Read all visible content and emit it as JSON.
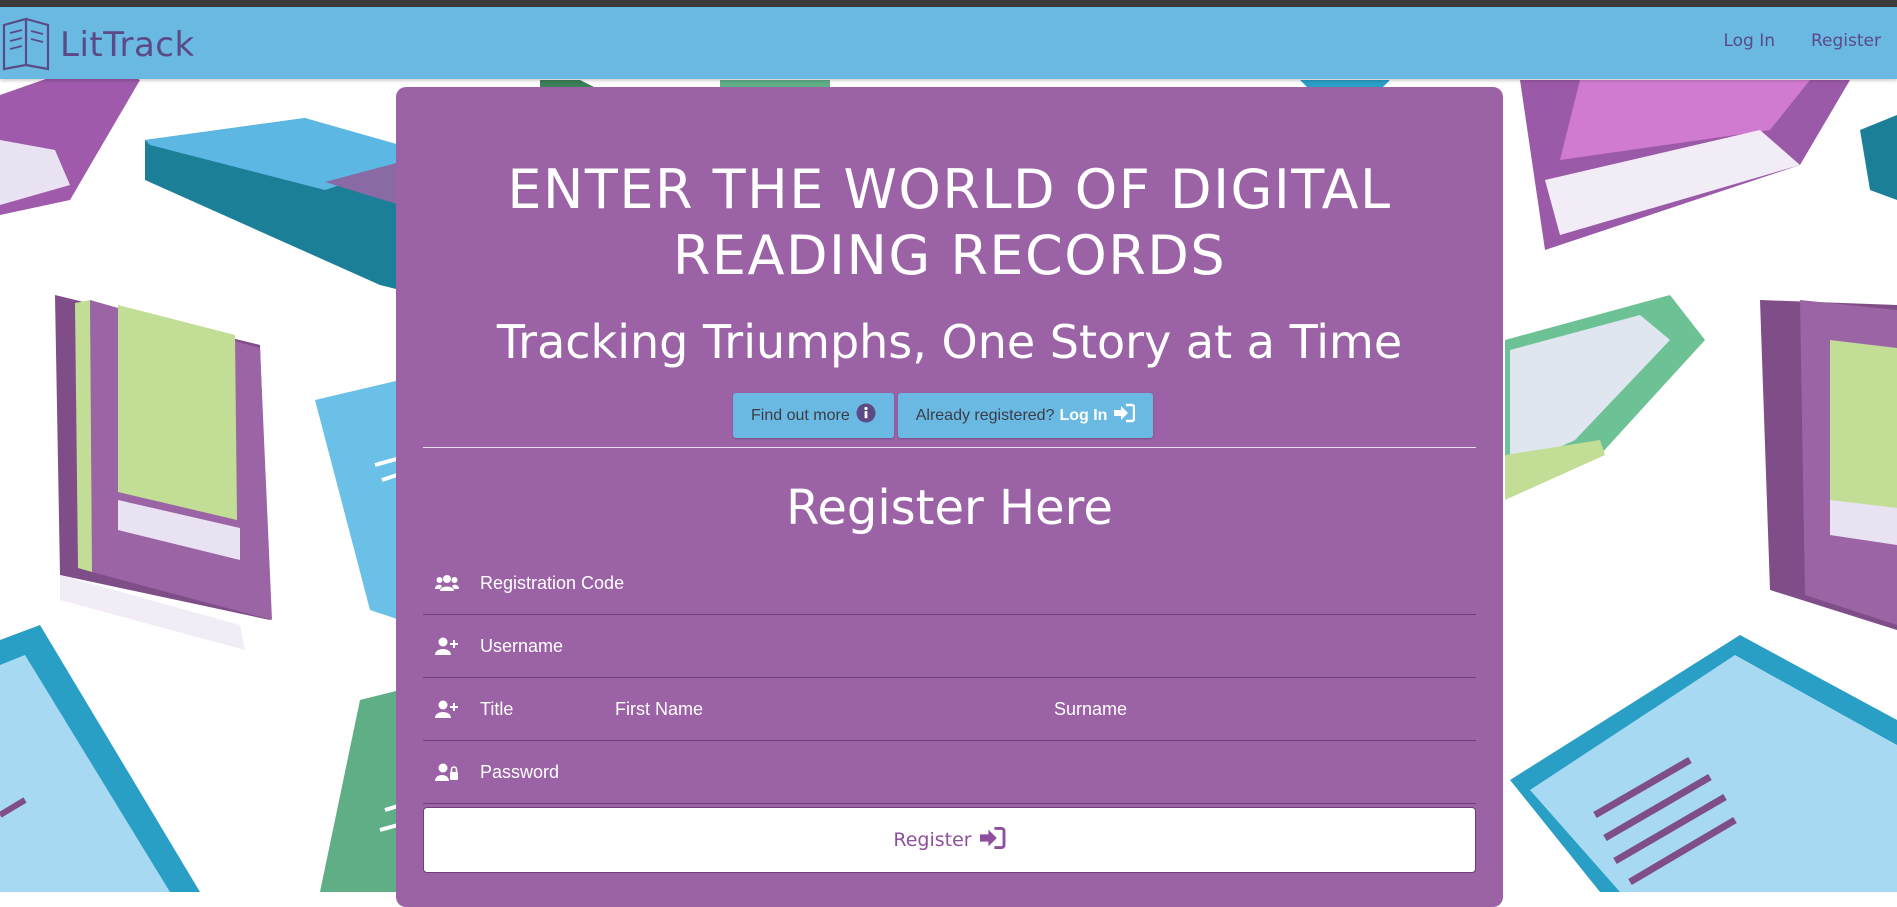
{
  "navbar": {
    "brand": "LitTrack",
    "links": [
      "Log In",
      "Register"
    ]
  },
  "hero": {
    "headline_line1": "ENTER THE WORLD OF DIGITAL",
    "headline_line2": "READING RECORDS",
    "tagline": "Tracking Triumphs, One Story at a Time",
    "find_out_more": "Find out more",
    "already_registered": "Already registered?",
    "login_label": "Log In"
  },
  "form": {
    "title": "Register Here",
    "registration_code_placeholder": "Registration Code",
    "username_placeholder": "Username",
    "title_placeholder": "Title",
    "first_name_placeholder": "First Name",
    "surname_placeholder": "Surname",
    "password_placeholder": "Password",
    "submit_label": "Register"
  },
  "icons": {
    "logo": "book-icon",
    "info": "info-circle-icon",
    "login": "sign-in-icon",
    "group": "users-icon",
    "user_plus": "user-plus-icon",
    "user_lock": "user-lock-icon"
  },
  "colors": {
    "navbar": "#69b9e3",
    "panel": "#9b63a6",
    "brand_text": "#5b4a86",
    "button_blue": "#69b9e3",
    "register_text": "#8e4f9d"
  }
}
